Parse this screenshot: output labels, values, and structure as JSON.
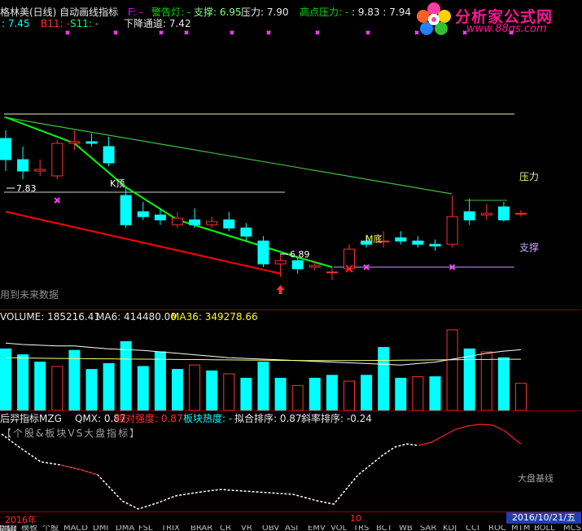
{
  "header": {
    "title": "格林美(日线) 自动画线指标",
    "f_label": "F: -",
    "warning_label": "警告灯: -",
    "support_label": "支撑: 6.95",
    "pressure_label": "压力: 7.90",
    "high_pressure_label": "高点压力: -",
    "high_values": ": 9.83 : 7.94",
    "row2_a": ": 7.45",
    "row2_b": "B11: -",
    "row2_s": "S11: -",
    "down_channel": "下降通道: 7.42"
  },
  "logo": {
    "text": "分析家公式网",
    "url": "www.88gs.com"
  },
  "main_chart": {
    "top_label": "K顶",
    "bottom_label": "M底",
    "pressure_tag": "压力",
    "support_tag": "支撑",
    "price_high_label": "7.83",
    "price_low_label": "6.89",
    "future_data_note": "用到未来数据"
  },
  "volume_panel": {
    "volume_label": "VOLUME: 185216.41",
    "ma6_label": "MA6: 414480.00",
    "ma36_label": "MA36: 349278.66"
  },
  "indicator_panel": {
    "name": "后羿指标MZG",
    "qmx": "QMX: 0.87",
    "relative_strength": "相对强度: 0.87",
    "sector_heat": "板块热度: -",
    "fit_rank": "拟合排序: 0.87",
    "slope_rank": "斜率排序: -0.24",
    "subtitle": "【个股&板块VS大盘指标】",
    "baseline_label": "大盘基线"
  },
  "time_axis": {
    "year_label": "2016年",
    "month_label": "10",
    "date_badge": "2016/10/21/五"
  },
  "bottom_tabs": [
    "指标",
    "模板",
    "个股",
    "MACD",
    "DMI",
    "DMA",
    "FSL",
    "TRIX",
    "BRAR",
    "CR",
    "VR",
    "OBV",
    "ASI",
    "EMV",
    "VOL",
    "TRS",
    "BCT",
    "WB",
    "SAR",
    "KDJ",
    "CCI",
    "ROC",
    "MTM",
    "BOLL",
    "MCST"
  ],
  "colors": {
    "up_candle": "#ff3030",
    "down_candle": "#00ffff",
    "pressure_line": "#f0f0a0",
    "support_line": "#c8a0ff",
    "green_trend": "#00ff00",
    "red_trend": "#ff0000"
  },
  "chart_data": {
    "type": "candlestick",
    "candles": [
      {
        "o": 7.75,
        "c": 7.62,
        "h": 7.8,
        "l": 7.55
      },
      {
        "o": 7.62,
        "c": 7.55,
        "h": 7.7,
        "l": 7.5
      },
      {
        "o": 7.55,
        "c": 7.56,
        "h": 7.62,
        "l": 7.52
      },
      {
        "o": 7.52,
        "c": 7.72,
        "h": 7.74,
        "l": 7.5
      },
      {
        "o": 7.72,
        "c": 7.73,
        "h": 7.8,
        "l": 7.68
      },
      {
        "o": 7.73,
        "c": 7.72,
        "h": 7.78,
        "l": 7.7
      },
      {
        "o": 7.7,
        "c": 7.6,
        "h": 7.76,
        "l": 7.58
      },
      {
        "o": 7.4,
        "c": 7.22,
        "h": 7.45,
        "l": 7.2
      },
      {
        "o": 7.3,
        "c": 7.27,
        "h": 7.36,
        "l": 7.25
      },
      {
        "o": 7.28,
        "c": 7.25,
        "h": 7.32,
        "l": 7.22
      },
      {
        "o": 7.22,
        "c": 7.26,
        "h": 7.3,
        "l": 7.2
      },
      {
        "o": 7.25,
        "c": 7.22,
        "h": 7.32,
        "l": 7.2
      },
      {
        "o": 7.22,
        "c": 7.24,
        "h": 7.27,
        "l": 7.2
      },
      {
        "o": 7.25,
        "c": 7.2,
        "h": 7.3,
        "l": 7.18
      },
      {
        "o": 7.2,
        "c": 7.15,
        "h": 7.23,
        "l": 7.12
      },
      {
        "o": 7.12,
        "c": 6.98,
        "h": 7.15,
        "l": 6.96
      },
      {
        "o": 6.98,
        "c": 7.0,
        "h": 7.04,
        "l": 6.9
      },
      {
        "o": 7.0,
        "c": 6.95,
        "h": 7.02,
        "l": 6.92
      },
      {
        "o": 6.96,
        "c": 6.97,
        "h": 7.0,
        "l": 6.94
      },
      {
        "o": 6.93,
        "c": 6.93,
        "h": 6.96,
        "l": 6.88
      },
      {
        "o": 6.95,
        "c": 7.07,
        "h": 7.1,
        "l": 6.94
      },
      {
        "o": 7.12,
        "c": 7.1,
        "h": 7.16,
        "l": 7.08
      },
      {
        "o": 7.12,
        "c": 7.12,
        "h": 7.18,
        "l": 7.08
      },
      {
        "o": 7.14,
        "c": 7.12,
        "h": 7.18,
        "l": 7.1
      },
      {
        "o": 7.12,
        "c": 7.1,
        "h": 7.15,
        "l": 7.08
      },
      {
        "o": 7.1,
        "c": 7.09,
        "h": 7.13,
        "l": 7.06
      },
      {
        "o": 7.1,
        "c": 7.27,
        "h": 7.4,
        "l": 7.08
      },
      {
        "o": 7.3,
        "c": 7.25,
        "h": 7.38,
        "l": 7.22
      },
      {
        "o": 7.28,
        "c": 7.29,
        "h": 7.35,
        "l": 7.25
      },
      {
        "o": 7.33,
        "c": 7.25,
        "h": 7.36,
        "l": 7.24
      },
      {
        "o": 7.29,
        "c": 7.29,
        "h": 7.31,
        "l": 7.27
      }
    ],
    "volume": {
      "values": [
        420000,
        380000,
        330000,
        300000,
        410000,
        280000,
        320000,
        470000,
        300000,
        400000,
        280000,
        310000,
        270000,
        250000,
        220000,
        330000,
        220000,
        170000,
        220000,
        240000,
        200000,
        240000,
        430000,
        220000,
        230000,
        230000,
        550000,
        420000,
        400000,
        360000,
        185216
      ],
      "up": [
        false,
        false,
        false,
        true,
        false,
        false,
        false,
        false,
        false,
        false,
        false,
        true,
        false,
        true,
        false,
        false,
        false,
        true,
        false,
        false,
        true,
        false,
        false,
        false,
        true,
        false,
        true,
        false,
        true,
        false,
        true
      ],
      "ma6": [
        460000,
        450000,
        445000,
        440000,
        440000,
        430000,
        420000,
        415000,
        410000,
        400000,
        390000,
        380000,
        370000,
        360000,
        355000,
        350000,
        345000,
        340000,
        335000,
        330000,
        325000,
        320000,
        315000,
        310000,
        320000,
        330000,
        350000,
        370000,
        390000,
        405000,
        414480
      ],
      "ma36": [
        360000,
        358000,
        356000,
        355000,
        354000,
        353000,
        352000,
        351000,
        350000,
        349000,
        348000,
        347000,
        346000,
        345000,
        344000,
        343000,
        342000,
        341000,
        340000,
        340000,
        340000,
        341000,
        342000,
        343000,
        344000,
        345000,
        346000,
        347000,
        348000,
        349000,
        349278
      ]
    }
  }
}
